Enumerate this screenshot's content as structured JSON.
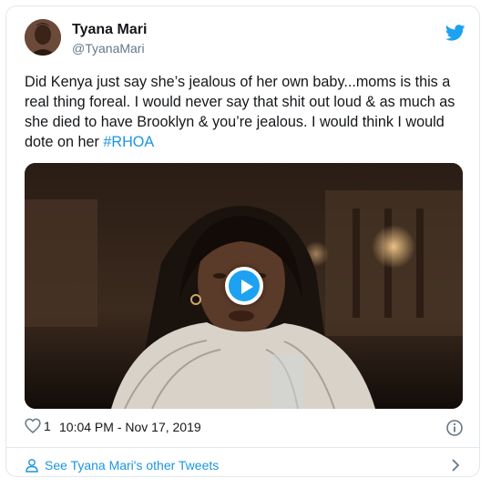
{
  "tweet": {
    "display_name": "Tyana Mari",
    "handle": "@TyanaMari",
    "text_main": "Did Kenya just say she’s jealous of her own baby...moms is this a real thing foreal. I would never say that shit out loud & as much as she died to have Brooklyn & you’re jealous. I would think I would dote on her ",
    "hashtag": "#RHOA",
    "like_count": "1",
    "timestamp": "10:04 PM - Nov 17, 2019"
  },
  "footer": {
    "label": "See Tyana Mari's other Tweets"
  },
  "colors": {
    "link": "#1b95e0",
    "twitter_blue": "#1da1f2",
    "text": "#14171a",
    "muted": "#657786",
    "border": "#e1e8ed"
  },
  "icons": {
    "brand": "twitter-bird-icon",
    "like": "heart-icon",
    "info": "info-icon",
    "play": "play-icon",
    "person": "person-icon",
    "chevron": "chevron-right-icon"
  }
}
